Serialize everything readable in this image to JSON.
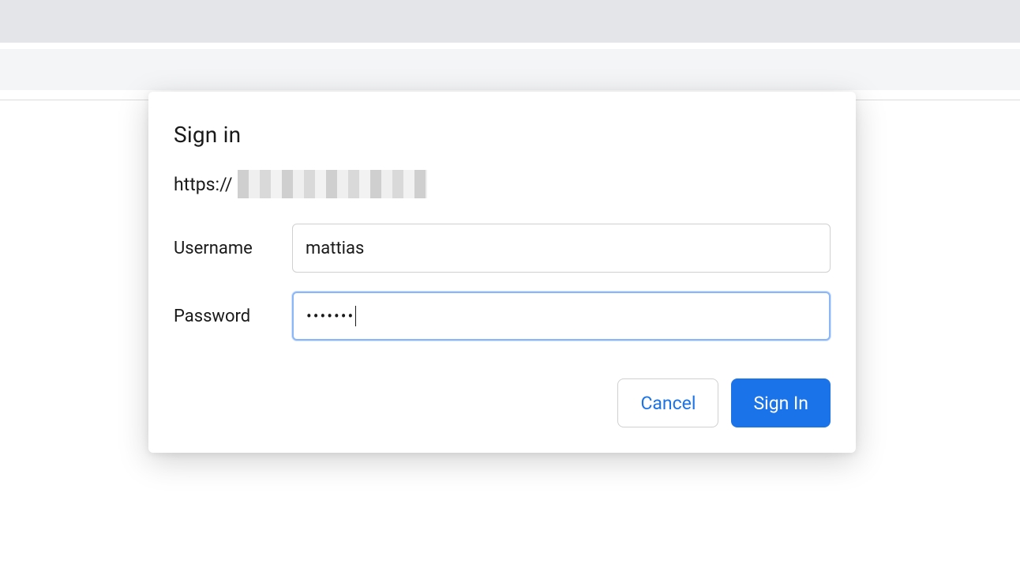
{
  "dialog": {
    "title": "Sign in",
    "url_prefix": "https://",
    "username_label": "Username",
    "username_value": "mattias",
    "password_label": "Password",
    "password_masked": "•••••••",
    "cancel_label": "Cancel",
    "signin_label": "Sign In"
  }
}
